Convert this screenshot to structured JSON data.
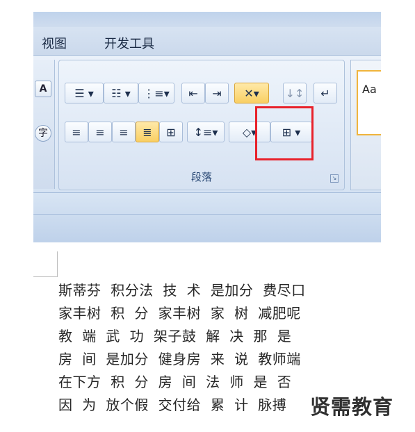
{
  "ribbon": {
    "tabs": [
      {
        "label": "视图"
      },
      {
        "label": "开发工具"
      }
    ],
    "paragraph_group": {
      "label": "段落",
      "highlighted_button": "asian-layout-button"
    },
    "styles_preview": "Aa"
  },
  "document": {
    "lines": [
      "斯蒂芬  积分法  技  术  是加分  费尽口",
      "家丰树  积  分  家丰树  家  树  减肥呢",
      "教  端  武  功  架子鼓  解  决  那  是",
      "房  间  是加分  健身房  来  说  教师端",
      "在下方  积  分  房  间  法  师  是  否",
      "因  为  放个假  交付给  累  计  脉搏"
    ]
  },
  "watermark": "贤需教育",
  "colors": {
    "highlight_border": "#e8212a",
    "ribbon_bg": "#dbe6f3",
    "active_button": "#f9cf63"
  }
}
